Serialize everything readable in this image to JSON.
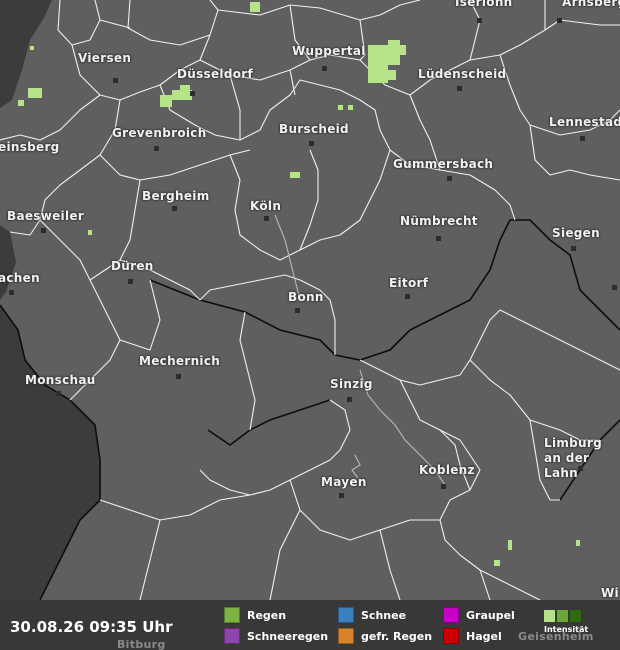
{
  "map": {
    "cities": [
      {
        "name": "Iserlohn"
      },
      {
        "name": "Arnsberg"
      },
      {
        "name": "Viersen"
      },
      {
        "name": "Wuppertal"
      },
      {
        "name": "Düsseldorf"
      },
      {
        "name": "Lüdenscheid"
      },
      {
        "name": "Grevenbroich"
      },
      {
        "name": "Burscheid"
      },
      {
        "name": "Lennestadt"
      },
      {
        "name": "einsberg"
      },
      {
        "name": "Gummersbach"
      },
      {
        "name": "Bergheim"
      },
      {
        "name": "Köln"
      },
      {
        "name": "Baesweiler"
      },
      {
        "name": "Nümbrecht"
      },
      {
        "name": "Siegen"
      },
      {
        "name": "achen"
      },
      {
        "name": "Düren"
      },
      {
        "name": "Eitorf"
      },
      {
        "name": "Bonn"
      },
      {
        "name": "Mechernich"
      },
      {
        "name": "Monschau"
      },
      {
        "name": "Sinzig"
      },
      {
        "name": "Limburg an der Lahn"
      },
      {
        "name": "Koblenz"
      },
      {
        "name": "Mayen"
      },
      {
        "name": "Wi"
      },
      {
        "name": "Bitburg"
      },
      {
        "name": "Geisenheim"
      }
    ]
  },
  "footer": {
    "timestamp": "30.08.26 09:35 Uhr",
    "legend": [
      {
        "label": "Regen",
        "color": "#7cb342"
      },
      {
        "label": "Schneeregen",
        "color": "#8e44ad"
      },
      {
        "label": "Schnee",
        "color": "#3a7fc0"
      },
      {
        "label": "gefr. Regen",
        "color": "#d9822b"
      },
      {
        "label": "Graupel",
        "color": "#c800c8"
      },
      {
        "label": "Hagel",
        "color": "#cc0000"
      }
    ],
    "intensity_label": "Intensität",
    "intensity_colors": [
      "#b6e388",
      "#6aa838",
      "#2f6b12"
    ]
  }
}
